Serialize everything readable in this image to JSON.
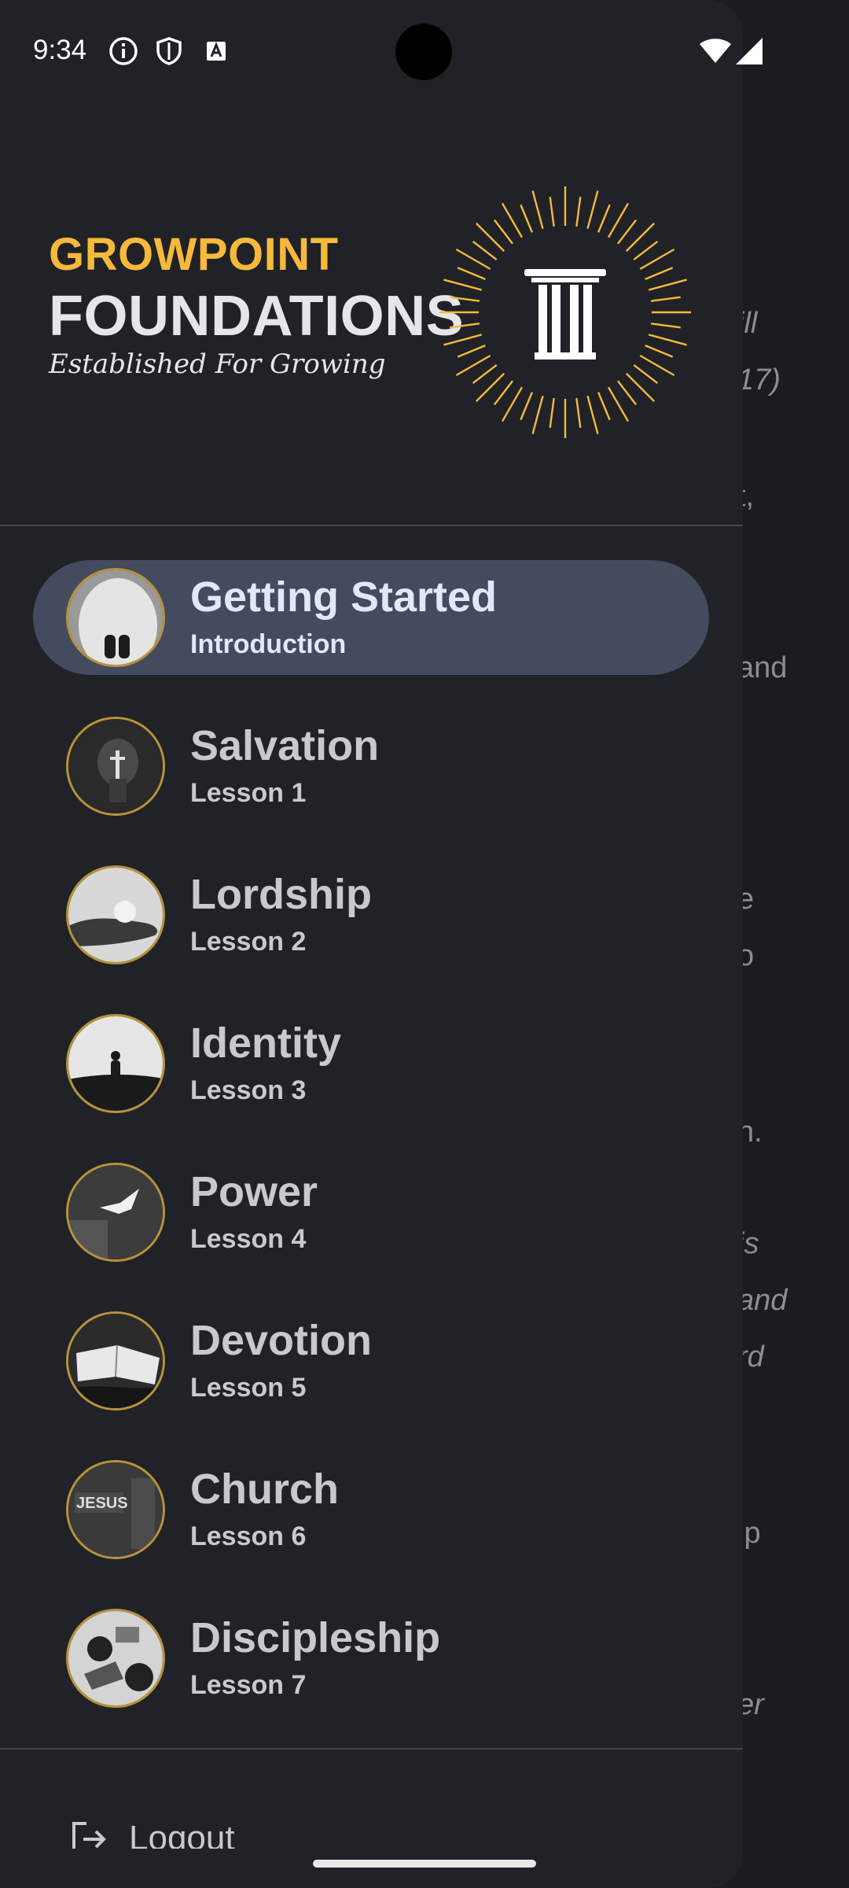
{
  "status_bar": {
    "time": "9:34",
    "icons": [
      "info-icon",
      "shield-icon",
      "keyboard-a-icon",
      "wifi-icon",
      "signal-icon"
    ]
  },
  "brand": {
    "top": "GROWPOINT",
    "main": "FOUNDATIONS",
    "tagline": "Established For Growing",
    "accent_color": "#f6b93b"
  },
  "lessons": [
    {
      "title": "Getting Started",
      "subtitle": "Introduction",
      "selected": true
    },
    {
      "title": "Salvation",
      "subtitle": "Lesson 1"
    },
    {
      "title": "Lordship",
      "subtitle": "Lesson 2"
    },
    {
      "title": "Identity",
      "subtitle": "Lesson 3"
    },
    {
      "title": "Power",
      "subtitle": "Lesson 4"
    },
    {
      "title": "Devotion",
      "subtitle": "Lesson 5"
    },
    {
      "title": "Church",
      "subtitle": "Lesson 6"
    },
    {
      "title": "Discipleship",
      "subtitle": "Lesson 7"
    }
  ],
  "footer": {
    "logout_label": "Logout"
  },
  "background_fragments": [
    "ill",
    "17)",
    "t,",
    "and",
    "e",
    "o",
    "n.",
    "is",
    "and",
    "rd",
    "ip",
    "er"
  ]
}
